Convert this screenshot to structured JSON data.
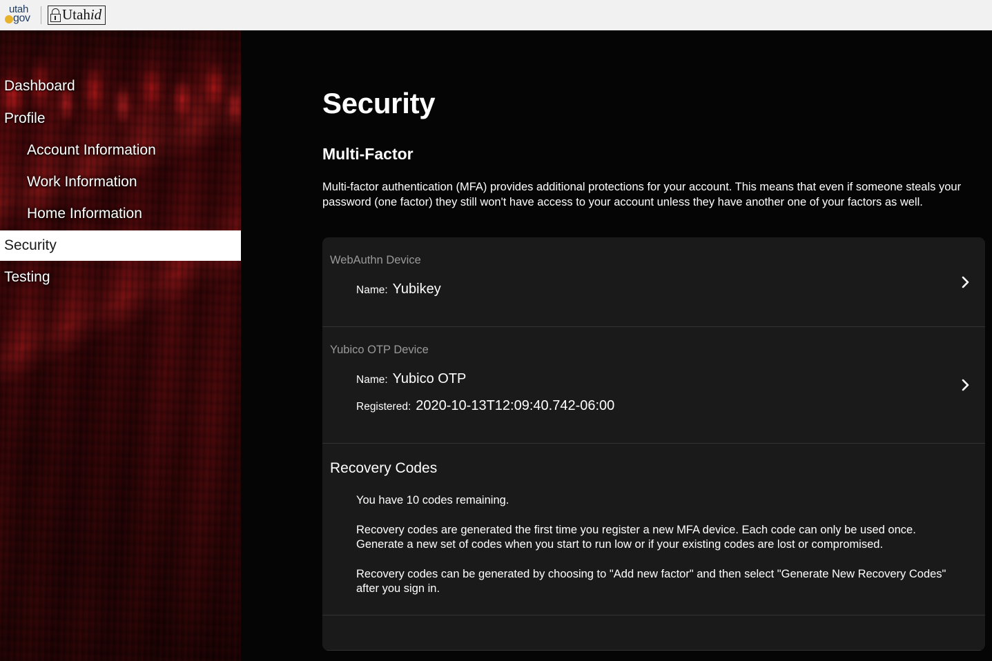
{
  "header": {
    "utah_gov_logo": {
      "line1": "utah",
      "line2": "gov",
      "icon": "utah-gov-dot-icon"
    },
    "utahid_logo": {
      "text_main": "Utah",
      "text_italic": "id",
      "icon": "lock-icon"
    }
  },
  "sidebar": {
    "items": [
      {
        "label": "Dashboard",
        "level": "top",
        "active": false
      },
      {
        "label": "Profile",
        "level": "top",
        "active": false
      },
      {
        "label": "Account Information",
        "level": "sub",
        "active": false
      },
      {
        "label": "Work Information",
        "level": "sub",
        "active": false
      },
      {
        "label": "Home Information",
        "level": "sub",
        "active": false
      },
      {
        "label": "Security",
        "level": "top",
        "active": true
      },
      {
        "label": "Testing",
        "level": "top",
        "active": false
      }
    ],
    "active_text_color": "#1a1a1a",
    "active_background": "#ffffff",
    "background_theme": "dark-red-canyon-photo"
  },
  "main": {
    "page_title": "Security",
    "section_title": "Multi-Factor",
    "intro_paragraph": "Multi-factor authentication (MFA) provides additional protections for your account. This means that even if someone steals your password (one factor) they still won't have access to your account unless they have another one of your factors as well.",
    "factors": [
      {
        "kind": "WebAuthn Device",
        "fields": [
          {
            "label": "Name:",
            "value": "Yubikey"
          }
        ],
        "chevron": "chevron-right-icon"
      },
      {
        "kind": "Yubico OTP Device",
        "fields": [
          {
            "label": "Name:",
            "value": "Yubico OTP"
          },
          {
            "label": "Registered:",
            "value": "2020-10-13T12:09:40.742-06:00"
          }
        ],
        "chevron": "chevron-right-icon"
      }
    ],
    "recovery": {
      "heading": "Recovery Codes",
      "remaining_text": "You have 10 codes remaining.",
      "paragraph_1": "Recovery codes are generated the first time you register a new MFA device. Each code can only be used once. Generate a new set of codes when you start to run low or if your existing codes are lost or compromised.",
      "paragraph_2": "Recovery codes can be generated by choosing to \"Add new factor\" and then select \"Generate New Recovery Codes\" after you sign in."
    }
  },
  "colors": {
    "page_background": "#050505",
    "card_background": "#1a1a1a",
    "card_divider": "#333333",
    "muted_text": "#9a9a9a",
    "primary_text": "#ffffff",
    "header_background": "#f1f1f1",
    "accent_gold": "#e8b22b"
  }
}
